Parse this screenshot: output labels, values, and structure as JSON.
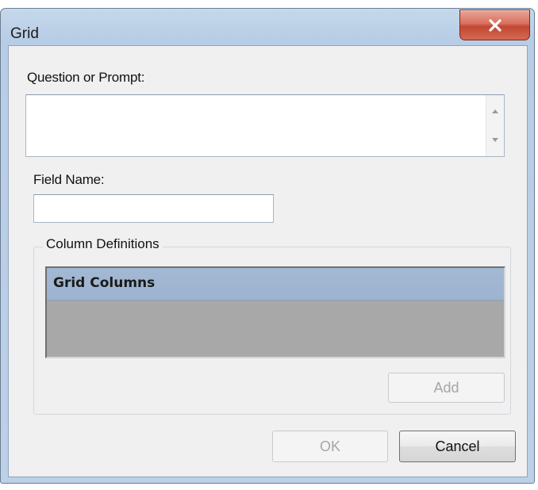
{
  "window": {
    "title": "Grid"
  },
  "prompt": {
    "label": "Question or Prompt:",
    "value": ""
  },
  "field_name": {
    "label": "Field Name:",
    "value": ""
  },
  "column_definitions": {
    "group_label": "Column Definitions",
    "grid_header": "Grid Columns",
    "add_label": "Add"
  },
  "footer": {
    "ok_label": "OK",
    "cancel_label": "Cancel"
  },
  "colors": {
    "frame": "#b9d1ea",
    "close_button": "#c34733",
    "grid_header": "#a2b8d3",
    "grid_body": "#a8a8a8"
  },
  "icons": {
    "close": "close-icon",
    "scroll_up": "scroll-up-arrow-icon",
    "scroll_down": "scroll-down-arrow-icon"
  }
}
